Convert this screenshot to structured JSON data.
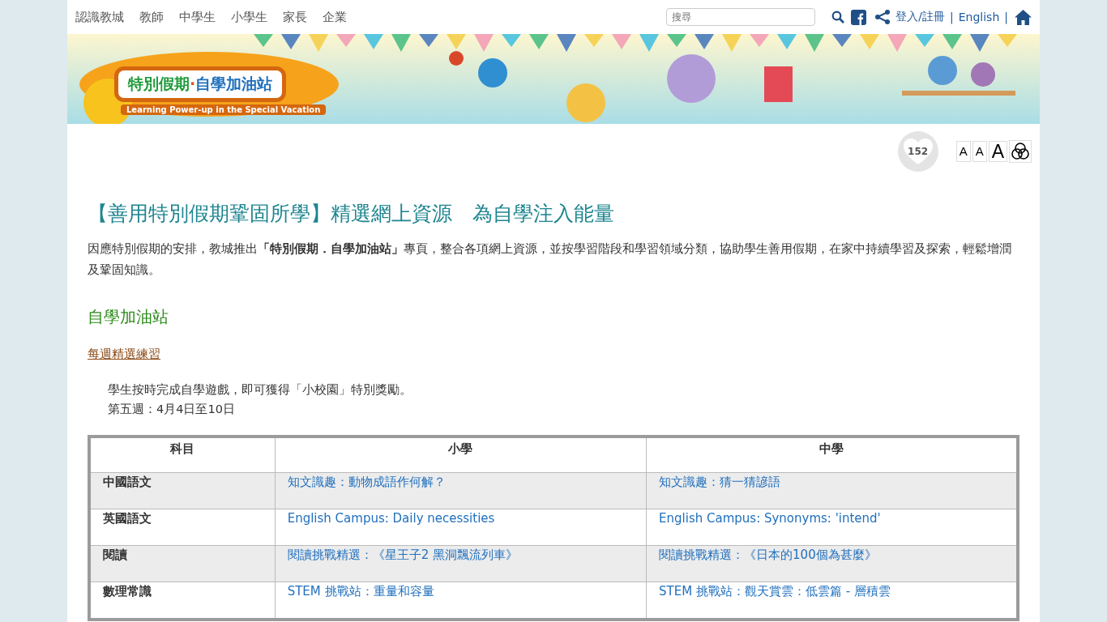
{
  "nav": {
    "items": [
      "認識教城",
      "教師",
      "中學生",
      "小學生",
      "家長",
      "企業"
    ],
    "search": {
      "placeholder": "搜尋"
    },
    "links": [
      "登入/註冊",
      "|",
      "English",
      "|"
    ]
  },
  "banner": {
    "kind": "picture",
    "title_left": "特別假期",
    "dot": "·",
    "title_right": "自學加油站",
    "subtitle": "Learning Power-up in the Special Vacation"
  },
  "likes": {
    "count": "152"
  },
  "font_sizes": [
    "A",
    "A",
    "A"
  ],
  "headline": "【善用特別假期鞏固所學】精選網上資源　為自學注入能量",
  "intro": "因應特別假期的安排，教城推出**「特別假期．自學加油站」**專頁，整合各項網上資源，並按學習階段和學習領域分類，協助學生善用假期，在家中持續學習及探索，輕鬆增潤及鞏固知識。",
  "section_title": "自學加油站",
  "weekly_link": "每週精選練習",
  "notes": [
    "學生按時完成自學遊戲，即可獲得「小校園」特別獎勵。",
    "第五週：4月4日至10日"
  ],
  "table": {
    "columns": [
      "科目",
      "小學",
      "中學"
    ],
    "rows": [
      {
        "subject": "中國語文",
        "primary": "知文識趣：動物成語作何解？",
        "secondary": "知文識趣：猜一猜諺語"
      },
      {
        "subject": "英國語文",
        "primary": "English Campus: Daily necessities",
        "secondary": "English Campus: Synonyms: 'intend'"
      },
      {
        "subject": "閱讀",
        "primary": "閱讀挑戰精選：《星王子2 黑洞飄流列車》",
        "secondary": "閱讀挑戰精選：《日本的100個為甚麼》"
      },
      {
        "subject": "數理常識",
        "primary": "STEM 挑戰站：重量和容量",
        "secondary": "STEM 挑戰站：觀天賞雲：低雲篇 - 層積雲"
      }
    ]
  }
}
